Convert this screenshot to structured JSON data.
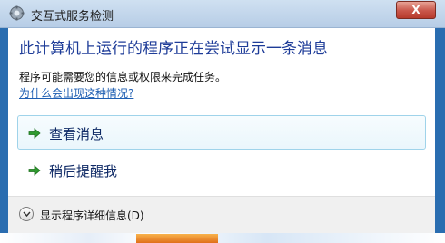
{
  "window": {
    "title": "交互式服务检测",
    "close_label": "X"
  },
  "main": {
    "heading": "此计算机上运行的程序正在尝试显示一条消息",
    "info": "程序可能需要您的信息或权限来完成任务。",
    "help_link": "为什么会出现这种情况?"
  },
  "commands": [
    {
      "label": "查看消息",
      "icon": "green-arrow-icon"
    },
    {
      "label": "稍后提醒我",
      "icon": "green-arrow-icon"
    }
  ],
  "footer": {
    "details_label": "显示程序详细信息(D)",
    "icon": "chevron-down-icon"
  },
  "colors": {
    "heading": "#1e3c98",
    "link": "#1f5fb3",
    "arrow": "#2f9a2f",
    "close": "#c9564a"
  }
}
